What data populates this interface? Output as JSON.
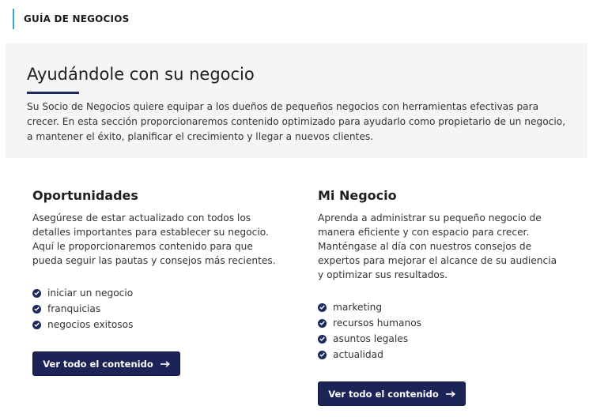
{
  "section_tag": "GUÍA DE NEGOCIOS",
  "hero": {
    "title": "Ayudándole con su negocio",
    "text": "Su Socio de Negocios quiere equipar a los dueños de pequeños negocios con herramientas efectivas para crecer. En esta sección proporcionaremos contenido optimizado para ayudarlo como propietario de un negocio, a mantener el éxito, planificar el crecimiento y llegar a nuevos clientes."
  },
  "columns": [
    {
      "title": "Oportunidades",
      "text": "Asegúrese de estar actualizado con todos los detalles importantes para establecer su negocio. Aquí le proporcionaremos contenido para que pueda seguir las pautas y consejos más recientes.",
      "items": [
        "iniciar un negocio",
        "franquicias",
        "negocios exitosos"
      ],
      "button_label": "Ver todo el contenido"
    },
    {
      "title": "Mi Negocio",
      "text": "Aprenda a administrar su pequeño negocio de manera eficiente y con espacio para crecer. Manténgase al día con nuestros consejos de expertos para mejorar el alcance de su audiencia y optimizar sus resultados.",
      "items": [
        "marketing",
        "recursos humanos",
        "asuntos legales",
        "actualidad"
      ],
      "button_label": "Ver todo el contenido"
    }
  ],
  "icons": {
    "bullet": "check-circle-icon",
    "button_arrow": "arrow-right-icon"
  },
  "colors": {
    "accent_bar": "#39a3c8",
    "navy": "#1c2457",
    "hero_bg": "#f5f5f6"
  }
}
